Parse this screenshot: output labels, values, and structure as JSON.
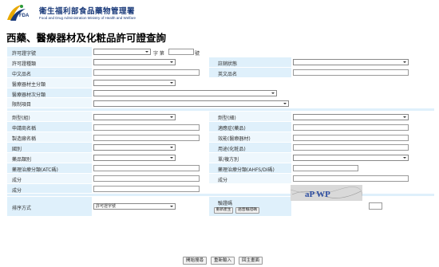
{
  "header": {
    "org_name": "衛生福利部食品藥物管理署",
    "org_en": "Food and Drug Administration Ministry of Health and Welfare",
    "logo_text": "FDA"
  },
  "page_title": "西藥、醫療器材及化粧品許可證查詢",
  "form": {
    "license_no_label": "許可證字號",
    "license_word": "字 第",
    "license_hao": "號",
    "license_type_label": "許可證種類",
    "cancel_status_label": "註銷狀態",
    "chinese_name_label": "中文品名",
    "english_name_label": "英文品名",
    "device_main_class_label": "醫療器材主分類",
    "device_sub_class_label": "醫療器材次分類",
    "control_item_label": "限制項目",
    "dosage_form_label": "劑型(組)",
    "dosage_form2_label": "劑型(細)",
    "applicant_label": "申請商名稱",
    "indication_label": "適應症(藥品)",
    "manufacturer_label": "製造廠名稱",
    "effect_label": "效能(醫療器材)",
    "country_label": "國別",
    "usage_label": "用途(化粧品)",
    "drug_category_label": "藥品類別",
    "single_compound_label": "單/複方別",
    "atc_label": "藥理治療分類(ATC碼)",
    "ahfs_label": "藥理治療分類(AHFS/DI碼)",
    "ingredient_label": "成分",
    "ingredient2_label": "成分",
    "ingredient3_label": "成分",
    "sort_label": "排序方式",
    "sort_value": "許可證字號",
    "captcha_label": "驗證碼",
    "captcha_refresh": "重新產生",
    "captcha_audio": "語音驗證碼",
    "captcha_text": "aP  WP"
  },
  "buttons": {
    "search": "開始搜尋",
    "reset": "重新輸入",
    "home": "回主畫面"
  }
}
